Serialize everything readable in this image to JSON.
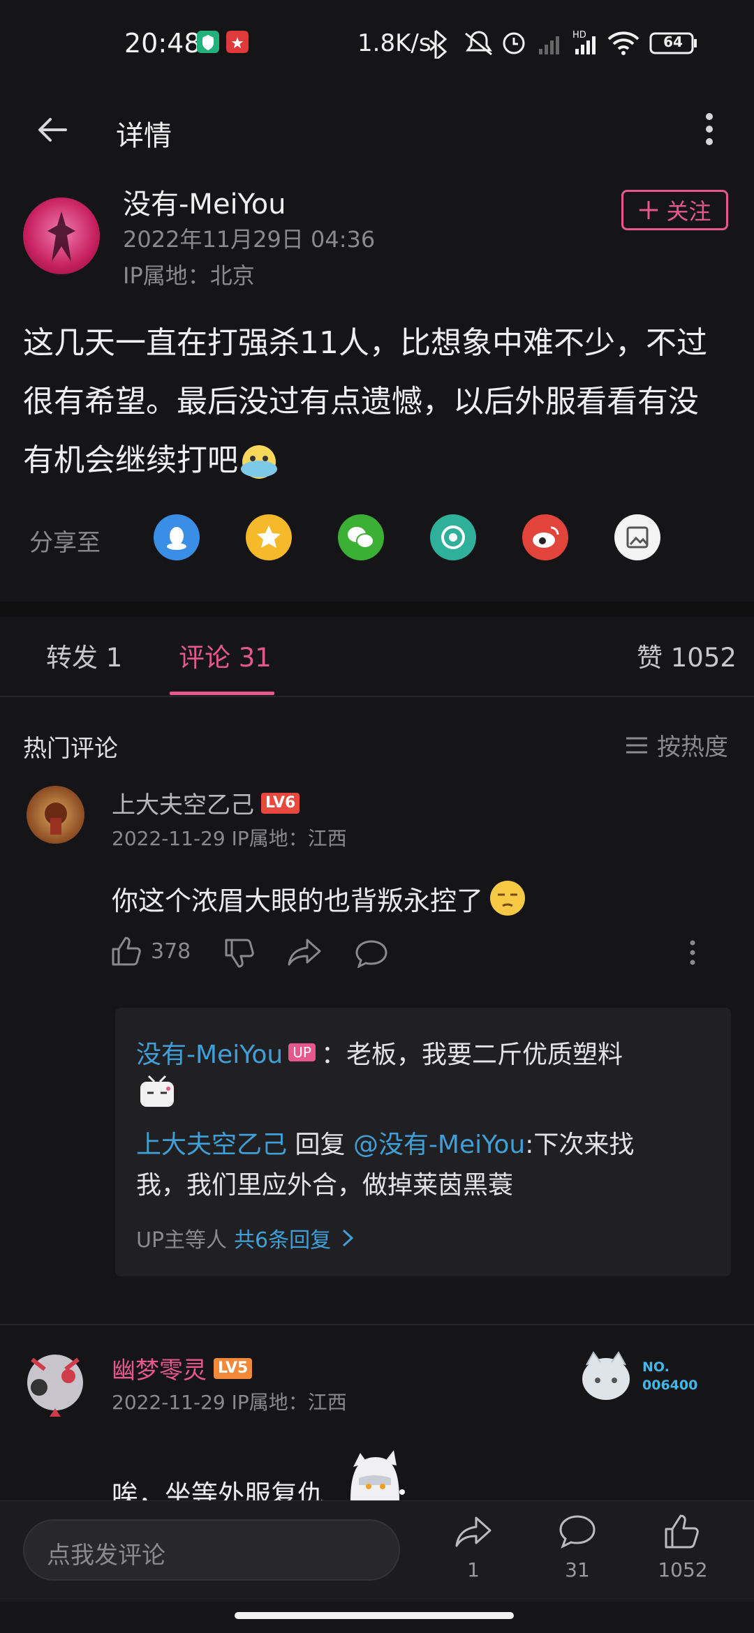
{
  "status_bar": {
    "time": "20:48",
    "net_speed": "1.8K/s",
    "battery": "64",
    "hd": "HD"
  },
  "header": {
    "title": "详情"
  },
  "post": {
    "author": "没有-MeiYou",
    "datetime": "2022年11月29日 04:36",
    "ip": "IP属地：北京",
    "follow_label": "关注",
    "content_line1": "这几天一直在打强杀11人，比想象中难不少，不过",
    "content_line2": "很有希望。最后没过有点遗憾，以后外服看看有没",
    "content_line3": "有机会继续打吧",
    "share_label": "分享至"
  },
  "tabs": {
    "repost": "转发 1",
    "comments": "评论 31",
    "likes": "赞 1052"
  },
  "comments_section": {
    "title": "热门评论",
    "sort_label": "按热度"
  },
  "comment1": {
    "author": "上大夫空乙己",
    "level": "LV6",
    "meta": "2022-11-29  IP属地：江西",
    "text": "你这个浓眉大眼的也背叛永控了",
    "likes": "378",
    "reply1_author": "没有-MeiYou",
    "reply1_badge": "UP",
    "reply1_text": "：老板，我要二斤优质塑料",
    "reply2_author": "上大夫空乙己",
    "reply2_verb": "回复",
    "reply2_mention": "@没有-MeiYou",
    "reply2_text_a": ":下次来找",
    "reply2_text_b": "我，我们里应外合，做掉莱茵黑蓑",
    "more_prefix": "UP主等人",
    "more_link": "共6条回复"
  },
  "comment2": {
    "author": "幽梦零灵",
    "level": "LV5",
    "meta": "2022-11-29  IP属地：江西",
    "badge_no": "NO.",
    "badge_num": "006400",
    "text_partial": "唉，坐等外服复仇"
  },
  "bottom_bar": {
    "input_placeholder": "点我发评论",
    "share_count": "1",
    "comment_count": "31",
    "like_count": "1052"
  }
}
